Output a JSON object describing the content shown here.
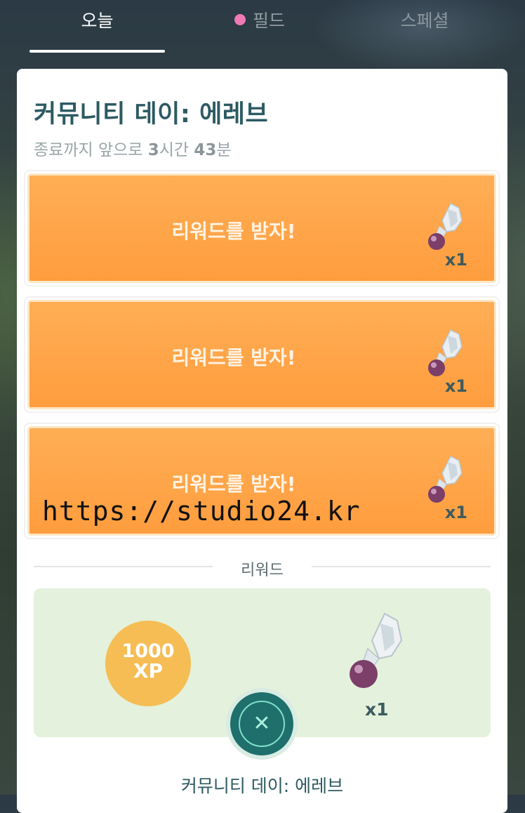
{
  "tabs": {
    "today": "오늘",
    "field": "필드",
    "special": "스페셜"
  },
  "research": {
    "title": "커뮤니티 데이: 에레브",
    "time_prefix": "종료까지 앞으로 ",
    "hours": "3",
    "hours_unit": "시간 ",
    "minutes": "43",
    "minutes_unit": "분",
    "steps": [
      {
        "label": "리워드를 받자!",
        "reward_icon": "elite-tm-shard-icon",
        "count": "x1"
      },
      {
        "label": "리워드를 받자!",
        "reward_icon": "elite-tm-shard-icon",
        "count": "x1"
      },
      {
        "label": "리워드를 받자!",
        "reward_icon": "elite-tm-shard-icon",
        "count": "x1"
      }
    ]
  },
  "rewards": {
    "section_label": "리워드",
    "xp_amount": "1000",
    "xp_unit": "XP",
    "item_icon": "elite-tm-shard-icon",
    "item_count": "x1"
  },
  "footer": {
    "title": "커뮤니티 데이: 에레브"
  },
  "watermark": "https://studio24.kr",
  "colors": {
    "step_orange": "#ff9d3e",
    "title_teal": "#2d5a63",
    "reward_green": "#e4f1dc",
    "xp_gold": "#f5bd54",
    "close_button": "#1f6f6d",
    "field_dot": "#f07ab6"
  }
}
